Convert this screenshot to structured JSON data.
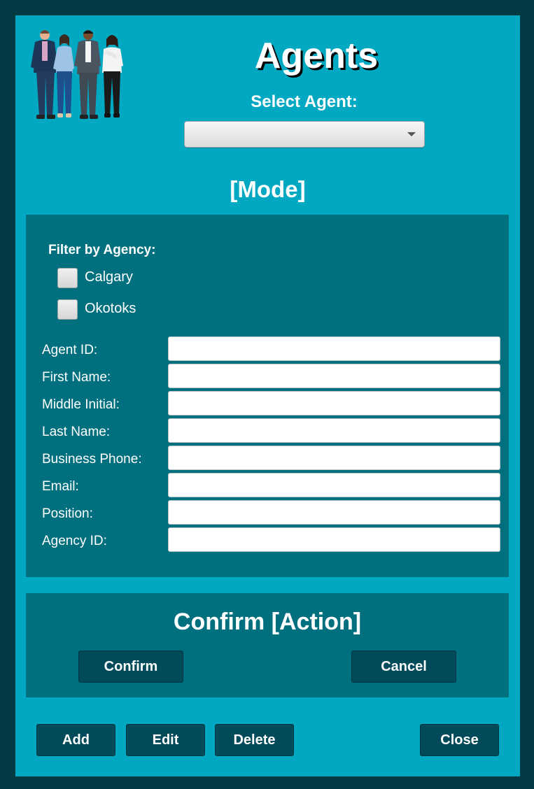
{
  "window": {
    "title": "Agents",
    "select_label": "Select Agent:",
    "select_value": "",
    "mode_title": "[Mode]"
  },
  "filter": {
    "label": "Filter by Agency:",
    "options": [
      {
        "label": "Calgary",
        "checked": false
      },
      {
        "label": "Okotoks",
        "checked": false
      }
    ]
  },
  "fields": [
    {
      "label": "Agent ID:",
      "value": ""
    },
    {
      "label": "First Name:",
      "value": ""
    },
    {
      "label": "Middle Initial:",
      "value": ""
    },
    {
      "label": "Last Name:",
      "value": ""
    },
    {
      "label": "Business Phone:",
      "value": ""
    },
    {
      "label": "Email:",
      "value": ""
    },
    {
      "label": "Position:",
      "value": ""
    },
    {
      "label": "Agency ID:",
      "value": ""
    }
  ],
  "confirm": {
    "title": "Confirm [Action]",
    "confirm_label": "Confirm",
    "cancel_label": "Cancel"
  },
  "actions": {
    "add_label": "Add",
    "edit_label": "Edit",
    "delete_label": "Delete",
    "close_label": "Close"
  },
  "colors": {
    "background": "#033a44",
    "window": "#00a8c2",
    "panel": "#00707f",
    "button": "#004a5a"
  },
  "icons": {
    "logo": "people-group-illustration",
    "dropdown": "chevron-down-icon"
  }
}
